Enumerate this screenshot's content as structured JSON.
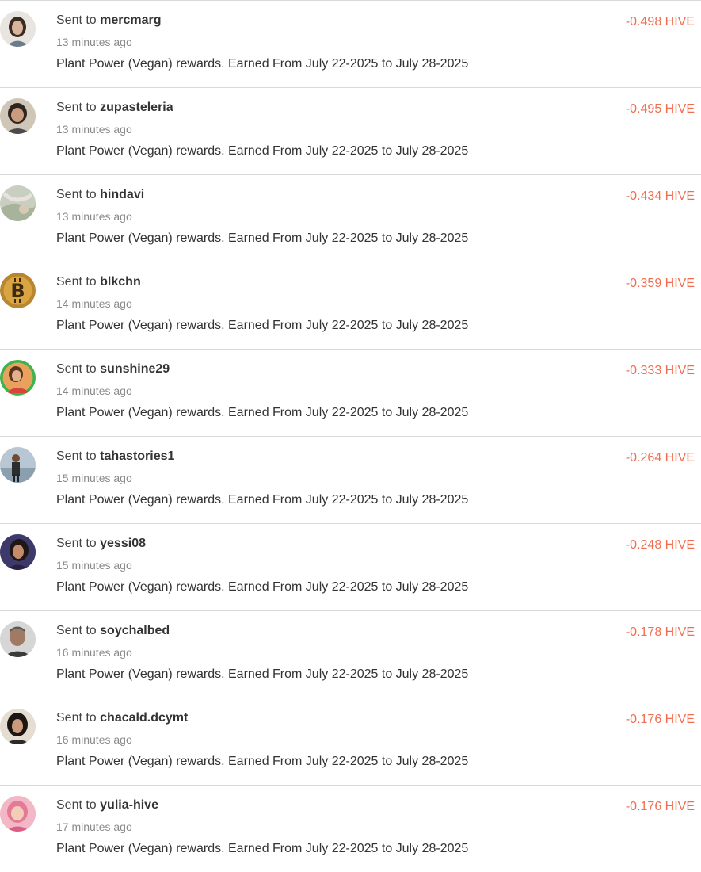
{
  "transactions": [
    {
      "prefix": "Sent to",
      "recipient": "mercmarg",
      "time": "13 minutes ago",
      "memo": "Plant Power (Vegan) rewards. Earned From July 22-2025 to July 28-2025",
      "amount": "-0.498 HIVE"
    },
    {
      "prefix": "Sent to",
      "recipient": "zupasteleria",
      "time": "13 minutes ago",
      "memo": "Plant Power (Vegan) rewards. Earned From July 22-2025 to July 28-2025",
      "amount": "-0.495 HIVE"
    },
    {
      "prefix": "Sent to",
      "recipient": "hindavi",
      "time": "13 minutes ago",
      "memo": "Plant Power (Vegan) rewards. Earned From July 22-2025 to July 28-2025",
      "amount": "-0.434 HIVE"
    },
    {
      "prefix": "Sent to",
      "recipient": "blkchn",
      "time": "14 minutes ago",
      "memo": "Plant Power (Vegan) rewards. Earned From July 22-2025 to July 28-2025",
      "amount": "-0.359 HIVE"
    },
    {
      "prefix": "Sent to",
      "recipient": "sunshine29",
      "time": "14 minutes ago",
      "memo": "Plant Power (Vegan) rewards. Earned From July 22-2025 to July 28-2025",
      "amount": "-0.333 HIVE"
    },
    {
      "prefix": "Sent to",
      "recipient": "tahastories1",
      "time": "15 minutes ago",
      "memo": "Plant Power (Vegan) rewards. Earned From July 22-2025 to July 28-2025",
      "amount": "-0.264 HIVE"
    },
    {
      "prefix": "Sent to",
      "recipient": "yessi08",
      "time": "15 minutes ago",
      "memo": "Plant Power (Vegan) rewards. Earned From July 22-2025 to July 28-2025",
      "amount": "-0.248 HIVE"
    },
    {
      "prefix": "Sent to",
      "recipient": "soychalbed",
      "time": "16 minutes ago",
      "memo": "Plant Power (Vegan) rewards. Earned From July 22-2025 to July 28-2025",
      "amount": "-0.178 HIVE"
    },
    {
      "prefix": "Sent to",
      "recipient": "chacald.dcymt",
      "time": "16 minutes ago",
      "memo": "Plant Power (Vegan) rewards. Earned From July 22-2025 to July 28-2025",
      "amount": "-0.176 HIVE"
    },
    {
      "prefix": "Sent to",
      "recipient": "yulia-hive",
      "time": "17 minutes ago",
      "memo": "Plant Power (Vegan) rewards. Earned From July 22-2025 to July 28-2025",
      "amount": "-0.176 HIVE"
    }
  ],
  "colors": {
    "amount": "#f26d4f",
    "text": "#333333",
    "muted": "#8a8a8a",
    "divider": "#d9d9d9"
  }
}
